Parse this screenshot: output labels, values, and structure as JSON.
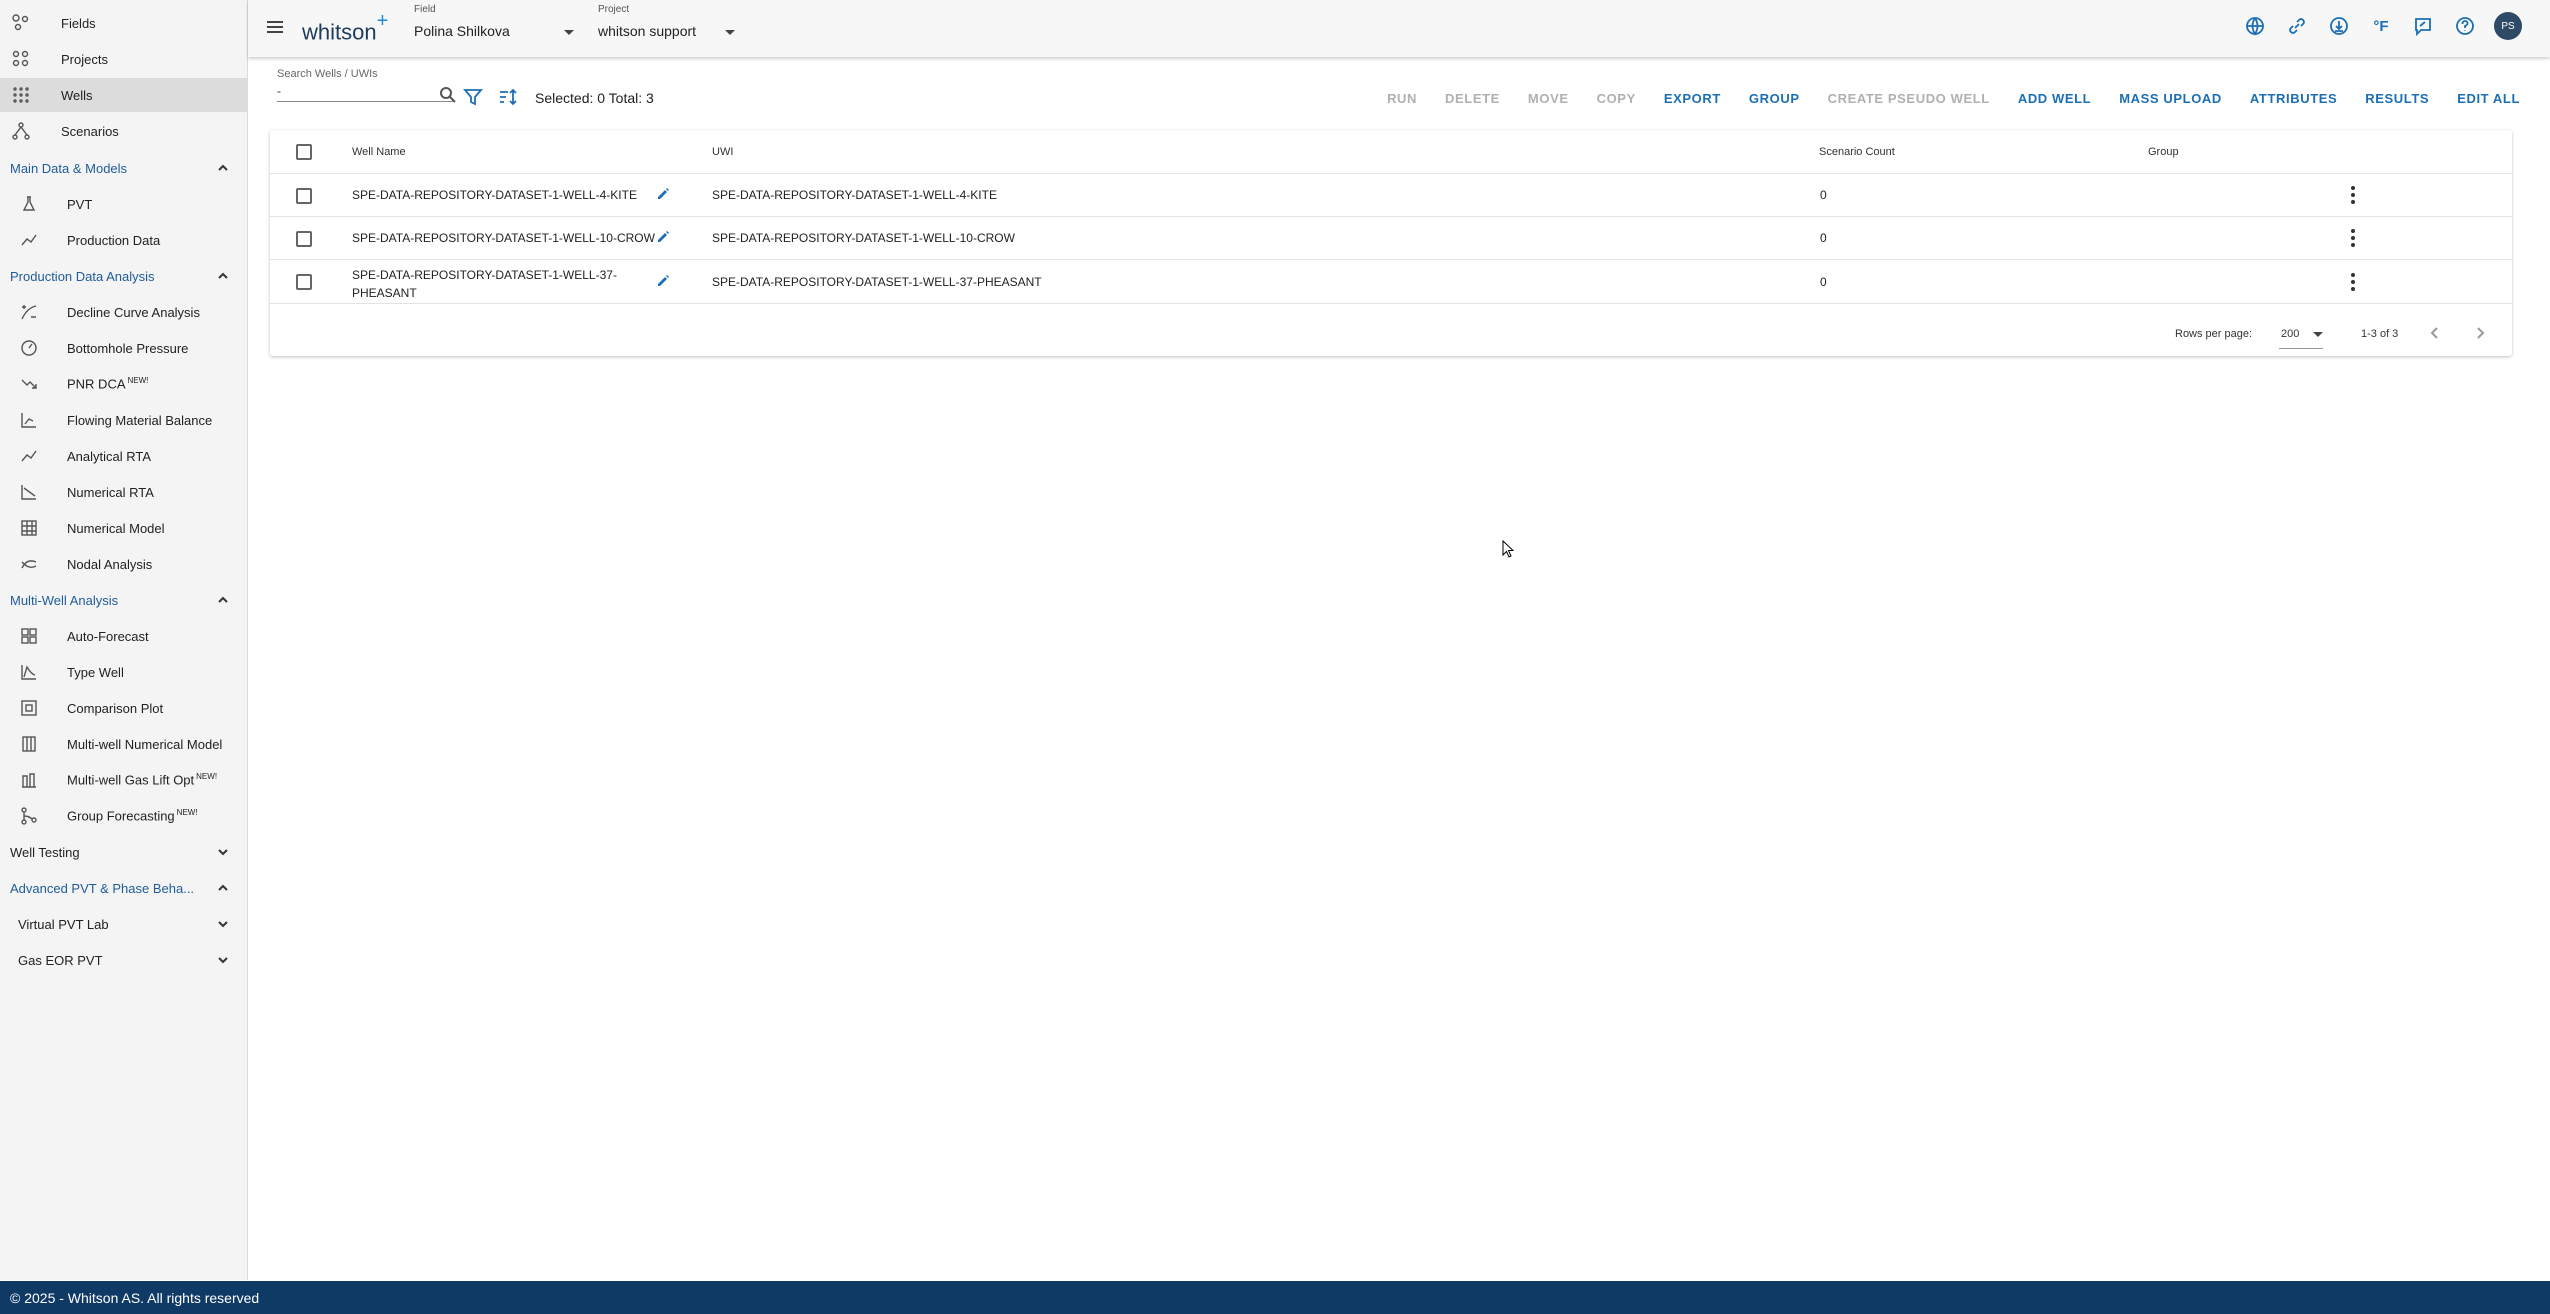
{
  "sidebar": {
    "top_items": [
      {
        "label": "Fields",
        "icon": "fields-icon"
      },
      {
        "label": "Projects",
        "icon": "projects-icon"
      },
      {
        "label": "Wells",
        "icon": "wells-icon"
      },
      {
        "label": "Scenarios",
        "icon": "scenarios-icon"
      }
    ],
    "sections": {
      "main_data": {
        "label": "Main Data & Models",
        "items": [
          {
            "label": "PVT"
          },
          {
            "label": "Production Data"
          }
        ]
      },
      "pda": {
        "label": "Production Data Analysis",
        "items": [
          {
            "label": "Decline Curve Analysis"
          },
          {
            "label": "Bottomhole Pressure"
          },
          {
            "label": "PNR DCA",
            "badge": "NEW!"
          },
          {
            "label": "Flowing Material Balance"
          },
          {
            "label": "Analytical RTA"
          },
          {
            "label": "Numerical RTA"
          },
          {
            "label": "Numerical Model"
          },
          {
            "label": "Nodal Analysis"
          }
        ]
      },
      "mwa": {
        "label": "Multi-Well Analysis",
        "items": [
          {
            "label": "Auto-Forecast"
          },
          {
            "label": "Type Well"
          },
          {
            "label": "Comparison Plot"
          },
          {
            "label": "Multi-well Numerical Model"
          },
          {
            "label": "Multi-well Gas Lift Opt",
            "badge": "NEW!"
          },
          {
            "label": "Group Forecasting",
            "badge": "NEW!"
          }
        ]
      },
      "well_testing": {
        "label": "Well Testing"
      },
      "advanced_pvt": {
        "label": "Advanced PVT & Phase Beha..."
      },
      "virtual_pvt": {
        "label": "Virtual PVT Lab"
      },
      "gas_eor": {
        "label": "Gas EOR PVT"
      }
    }
  },
  "header": {
    "logo_text": "whitson",
    "logo_plus": "+",
    "field_caption": "Field",
    "field_value": "Polina Shilkova",
    "project_caption": "Project",
    "project_value": "whitson support",
    "temp_unit": "°F",
    "avatar_initials": "PS"
  },
  "toolbar": {
    "search_caption": "Search Wells / UWIs",
    "search_value": "-",
    "selected_total": "Selected: 0 Total: 3",
    "actions": [
      {
        "label": "RUN",
        "enabled": false
      },
      {
        "label": "DELETE",
        "enabled": false
      },
      {
        "label": "MOVE",
        "enabled": false
      },
      {
        "label": "COPY",
        "enabled": false
      },
      {
        "label": "EXPORT",
        "enabled": true
      },
      {
        "label": "GROUP",
        "enabled": true
      },
      {
        "label": "CREATE PSEUDO WELL",
        "enabled": false
      },
      {
        "label": "ADD WELL",
        "enabled": true
      },
      {
        "label": "MASS UPLOAD",
        "enabled": true
      },
      {
        "label": "ATTRIBUTES",
        "enabled": true
      },
      {
        "label": "RESULTS",
        "enabled": true
      },
      {
        "label": "EDIT ALL",
        "enabled": true
      }
    ]
  },
  "table": {
    "columns": [
      "Well Name",
      "UWI",
      "Scenario Count",
      "Group"
    ],
    "rows": [
      {
        "name_line1": "SPE-DATA-REPOSITORY-DATASET-1-WELL-4-KITE",
        "name_line2": "",
        "uwi": "SPE-DATA-REPOSITORY-DATASET-1-WELL-4-KITE",
        "scenario_count": "0",
        "group": ""
      },
      {
        "name_line1": "SPE-DATA-REPOSITORY-DATASET-1-WELL-10-CROW",
        "name_line2": "",
        "uwi": "SPE-DATA-REPOSITORY-DATASET-1-WELL-10-CROW",
        "scenario_count": "0",
        "group": ""
      },
      {
        "name_line1": "SPE-DATA-REPOSITORY-DATASET-1-WELL-37-",
        "name_line2": "PHEASANT",
        "uwi": "SPE-DATA-REPOSITORY-DATASET-1-WELL-37-PHEASANT",
        "scenario_count": "0",
        "group": ""
      }
    ],
    "rows_per_page_label": "Rows per page:",
    "rows_per_page_value": "200",
    "range_label": "1-3 of 3"
  },
  "footer": {
    "text": "© 2025 - Whitson AS. All rights reserved"
  },
  "colors": {
    "accent": "#1c6fb5",
    "footer_bg": "#0f3a66",
    "section_header": "#1f5c99",
    "disabled": "#b0b0b0"
  }
}
